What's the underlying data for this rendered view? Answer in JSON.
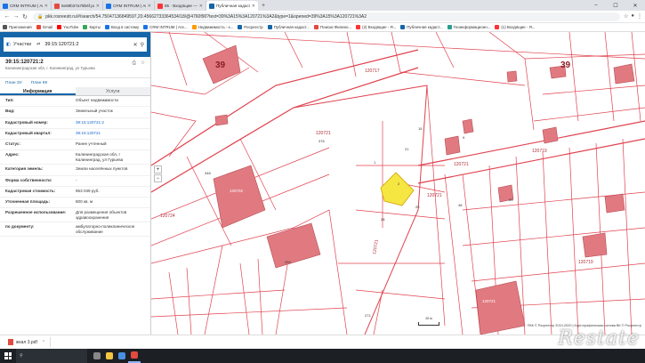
{
  "tabs": [
    {
      "label": "CRM INTRUM | Агентство недв",
      "color": "#1a73e8"
    },
    {
      "label": "5e89b37a78b6f.pdf",
      "color": "#e34a3f"
    },
    {
      "label": "CRM INTRUM | Агентство недв",
      "color": "#1a73e8"
    },
    {
      "label": "85 · Входящие — Яндекс.Почта",
      "color": "#f33"
    },
    {
      "label": "Публичная кадастровая карта",
      "color": "#1565a8",
      "active": true
    }
  ],
  "new_tab": "+",
  "window_controls": [
    "–",
    "☐",
    "✕"
  ],
  "url": "pkk.rosreestr.ru/#/search/54.75047136849597,20.45662733364534/18/@4760f90?text=39%3A15%3A120721%3A2&type=1&opened=39%3A15%3A120721%3A2",
  "bookmarks": [
    {
      "label": "Приложения",
      "color": "#555"
    },
    {
      "label": "Gmail",
      "color": "#ea4335"
    },
    {
      "label": "YouTube",
      "color": "#f00"
    },
    {
      "label": "Карты",
      "color": "#34a853"
    },
    {
      "label": "Вход в систему",
      "color": "#1a73e8"
    },
    {
      "label": "CRM INTRUM | Аге...",
      "color": "#1a73e8"
    },
    {
      "label": "Недвижимость - к...",
      "color": "#f90"
    },
    {
      "label": "Росреестр",
      "color": "#1565a8"
    },
    {
      "label": "Публичная кадаст...",
      "color": "#1565a8"
    },
    {
      "label": "Поиски Филино...",
      "color": "#e34a3f"
    },
    {
      "label": "(2) Входящие - Я...",
      "color": "#f33"
    },
    {
      "label": "Публичная кадаст...",
      "color": "#1565a8"
    },
    {
      "label": "Геоинформационн...",
      "color": "#2a9d8f"
    },
    {
      "label": "(1) Входящие - Я...",
      "color": "#f33"
    }
  ],
  "search": {
    "type": "Участки",
    "value": "39:15:120721:2"
  },
  "object": {
    "number": "39:15:120721:2",
    "address": "Калининградская обл, г. Калининград, ул Гурьева"
  },
  "plans": [
    "План ЗУ",
    "План КК"
  ],
  "subtabs": [
    "Информация",
    "Услуги"
  ],
  "info_rows": [
    {
      "k": "Тип:",
      "v": "Объект недвижимости"
    },
    {
      "k": "Вид:",
      "v": "Земельный участок"
    },
    {
      "k": "Кадастровый номер:",
      "v": "39:15:120721:2",
      "link": true
    },
    {
      "k": "Кадастровый квартал:",
      "v": "39:15:120721",
      "link": true
    },
    {
      "k": "Статус:",
      "v": "Ранее учтенный"
    },
    {
      "k": "Адрес:",
      "v": "Калининградская обл, г Калининград, ул Гурьева"
    },
    {
      "k": "Категория земель:",
      "v": "Земли населённых пунктов"
    },
    {
      "k": "Форма собственности:",
      "v": "-"
    },
    {
      "k": "Кадастровая стоимость:",
      "v": "953 049 руб."
    },
    {
      "k": "Уточненная площадь:",
      "v": "800 кв. м"
    },
    {
      "k": "Разрешенное использование:",
      "v": "Для размещения объектов здравоохранения"
    },
    {
      "k": "по документу:",
      "v": "амбулаторно-поликлиническое обслуживание"
    }
  ],
  "map": {
    "block_labels": [
      "39",
      "39"
    ],
    "quarter_labels": [
      "120717",
      "120719",
      "120721",
      "120721",
      "120721",
      "120719",
      "120724",
      "120721"
    ],
    "parcel_numbers": [
      "376",
      "348",
      "1",
      "21",
      "2",
      "25",
      "28",
      "48",
      "53",
      "259",
      "271",
      "15",
      "9"
    ],
    "building_labels": [
      "120702",
      "120721"
    ],
    "scale": "20 м",
    "copyright": "ПКК © Росреестр 2010-2020 | Картографическая основа ВК ©  Росреестр",
    "zoom_in": "+",
    "zoom_out": "−"
  },
  "downloads": {
    "file": "жкал 3.pdf"
  },
  "taskbar": {
    "search_placeholder": "",
    "apps": [
      {
        "name": "task-view",
        "color": "#888"
      },
      {
        "name": "explorer",
        "color": "#f4c542"
      },
      {
        "name": "mail",
        "color": "#4a90e2"
      },
      {
        "name": "chrome",
        "color": "#e34a3f"
      }
    ]
  },
  "watermark": "Restate",
  "colors": {
    "accent": "#1565a8",
    "parcel_line": "#e0424f",
    "building_fill": "#e07a80",
    "selected_fill": "#f5e642"
  }
}
